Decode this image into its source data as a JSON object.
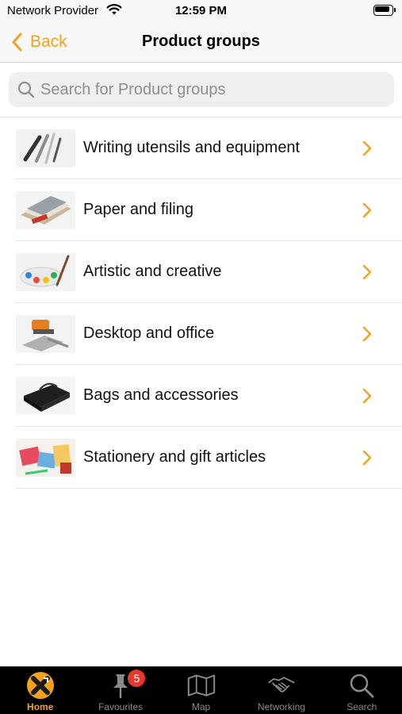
{
  "status_bar": {
    "carrier": "Network Provider",
    "time": "12:59 PM"
  },
  "nav": {
    "back_label": "Back",
    "title": "Product groups"
  },
  "search": {
    "placeholder": "Search for Product groups",
    "value": ""
  },
  "groups": [
    {
      "label": "Writing utensils and equipment",
      "icon": "pens-thumbnail"
    },
    {
      "label": "Paper and filing",
      "icon": "paper-thumbnail"
    },
    {
      "label": "Artistic and creative",
      "icon": "paints-thumbnail"
    },
    {
      "label": "Desktop and office",
      "icon": "stapler-thumbnail"
    },
    {
      "label": "Bags and accessories",
      "icon": "bag-thumbnail"
    },
    {
      "label": "Stationery and gift articles",
      "icon": "gifts-thumbnail"
    }
  ],
  "tabs": [
    {
      "label": "Home",
      "icon": "home-icon",
      "active": true
    },
    {
      "label": "Favourites",
      "icon": "pin-icon",
      "badge": "5"
    },
    {
      "label": "Map",
      "icon": "map-icon"
    },
    {
      "label": "Networking",
      "icon": "handshake-icon"
    },
    {
      "label": "Search",
      "icon": "search-icon"
    }
  ],
  "colors": {
    "accent": "#f2a21b",
    "tab_bar_bg": "#000000",
    "badge": "#e8382d"
  }
}
